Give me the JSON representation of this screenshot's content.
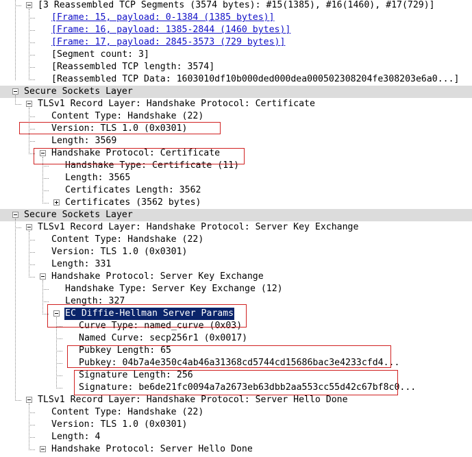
{
  "packet_details": {
    "rows": [
      {
        "text": "[3 Reassembled TCP Segments (3574 bytes): #15(1385), #16(1460), #17(729)]",
        "toggle": "minus"
      },
      {
        "text": "[Frame: 15, payload: 0-1384 (1385 bytes)]",
        "link": true
      },
      {
        "text": "[Frame: 16, payload: 1385-2844 (1460 bytes)]",
        "link": true
      },
      {
        "text": "[Frame: 17, payload: 2845-3573 (729 bytes)]",
        "link": true
      },
      {
        "text": "[Segment count: 3]"
      },
      {
        "text": "[Reassembled TCP length: 3574]"
      },
      {
        "text": "[Reassembled TCP Data: 1603010df10b000ded000dea000502308204fe308203e6a0...]"
      },
      {
        "text": "Secure Sockets Layer",
        "toggle": "minus",
        "section": true
      },
      {
        "text": "TLSv1 Record Layer: Handshake Protocol: Certificate",
        "toggle": "minus"
      },
      {
        "text": "Content Type: Handshake (22)"
      },
      {
        "text": "Version: TLS 1.0 (0x0301)"
      },
      {
        "text": "Length: 3569"
      },
      {
        "text": "Handshake Protocol: Certificate",
        "toggle": "minus"
      },
      {
        "text": "Handshake Type: Certificate (11)"
      },
      {
        "text": "Length: 3565"
      },
      {
        "text": "Certificates Length: 3562"
      },
      {
        "text": "Certificates (3562 bytes)",
        "toggle": "plus"
      },
      {
        "text": "Secure Sockets Layer",
        "toggle": "minus",
        "section": true
      },
      {
        "text": "TLSv1 Record Layer: Handshake Protocol: Server Key Exchange",
        "toggle": "minus"
      },
      {
        "text": "Content Type: Handshake (22)"
      },
      {
        "text": "Version: TLS 1.0 (0x0301)"
      },
      {
        "text": "Length: 331"
      },
      {
        "text": "Handshake Protocol: Server Key Exchange",
        "toggle": "minus"
      },
      {
        "text": "Handshake Type: Server Key Exchange (12)"
      },
      {
        "text": "Length: 327"
      },
      {
        "text": "EC Diffie-Hellman Server Params",
        "toggle": "minus",
        "selected": true
      },
      {
        "text": "Curve Type: named_curve (0x03)"
      },
      {
        "text": "Named Curve: secp256r1 (0x0017)"
      },
      {
        "text": "Pubkey Length: 65"
      },
      {
        "text": "Pubkey: 04b7a4e350c4ab46a31368cd5744cd15686bac3e4233cfd4..."
      },
      {
        "text": "Signature Length: 256"
      },
      {
        "text": "Signature: be6de21fc0094a7a2673eb63dbb2aa553cc55d42c67bf8c0..."
      },
      {
        "text": "TLSv1 Record Layer: Handshake Protocol: Server Hello Done",
        "toggle": "minus"
      },
      {
        "text": "Content Type: Handshake (22)"
      },
      {
        "text": "Version: TLS 1.0 (0x0301)"
      },
      {
        "text": "Length: 4"
      },
      {
        "text": "Handshake Protocol: Server Hello Done",
        "toggle": "minus"
      }
    ]
  },
  "colors": {
    "section_bg": "#dcdcdc",
    "selection_bg": "#0a246a",
    "link": "#1010c8",
    "highlight_box": "#d02020"
  }
}
